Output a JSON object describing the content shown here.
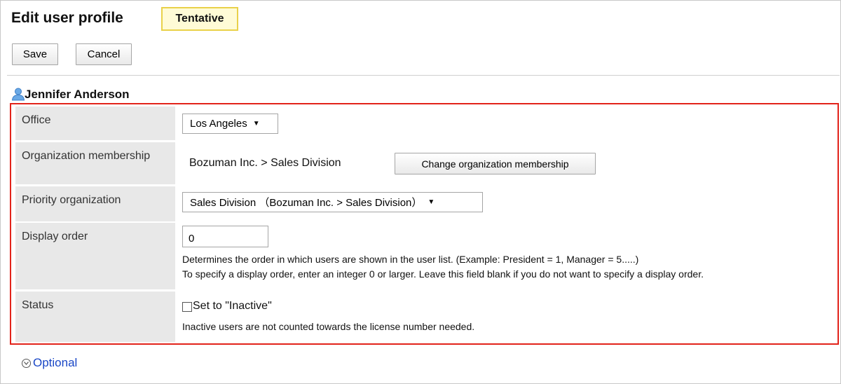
{
  "header": {
    "title": "Edit user profile",
    "status_badge": "Tentative"
  },
  "toolbar": {
    "save_label": "Save",
    "cancel_label": "Cancel"
  },
  "user": {
    "name": "Jennifer Anderson"
  },
  "form": {
    "office": {
      "label": "Office",
      "value": "Los Angeles"
    },
    "organization_membership": {
      "label": "Organization membership",
      "value": "Bozuman Inc. > Sales Division",
      "button_label": "Change organization membership"
    },
    "priority_organization": {
      "label": "Priority organization",
      "value": "Sales Division （Bozuman Inc. > Sales Division）"
    },
    "display_order": {
      "label": "Display order",
      "value": "0",
      "help_line1": "Determines the order in which users are shown in the user list. (Example: President = 1, Manager = 5.....)",
      "help_line2": "To specify a display order, enter an integer 0 or larger. Leave this field blank if you do not want to specify a display order."
    },
    "status": {
      "label": "Status",
      "checkbox_label": "Set to \"Inactive\"",
      "checked": false,
      "help": "Inactive users are not counted towards the license number needed."
    }
  },
  "optional_link": "Optional",
  "colors": {
    "highlight_border": "#e2231a",
    "badge_border": "#e9d14a",
    "badge_bg": "#fffbd6",
    "link": "#1a47c6",
    "label_bg": "#e8e8e8"
  },
  "icons": {
    "user": "user-icon",
    "expand": "chevron-down-circle-icon",
    "dropdown": "caret-down-icon"
  }
}
